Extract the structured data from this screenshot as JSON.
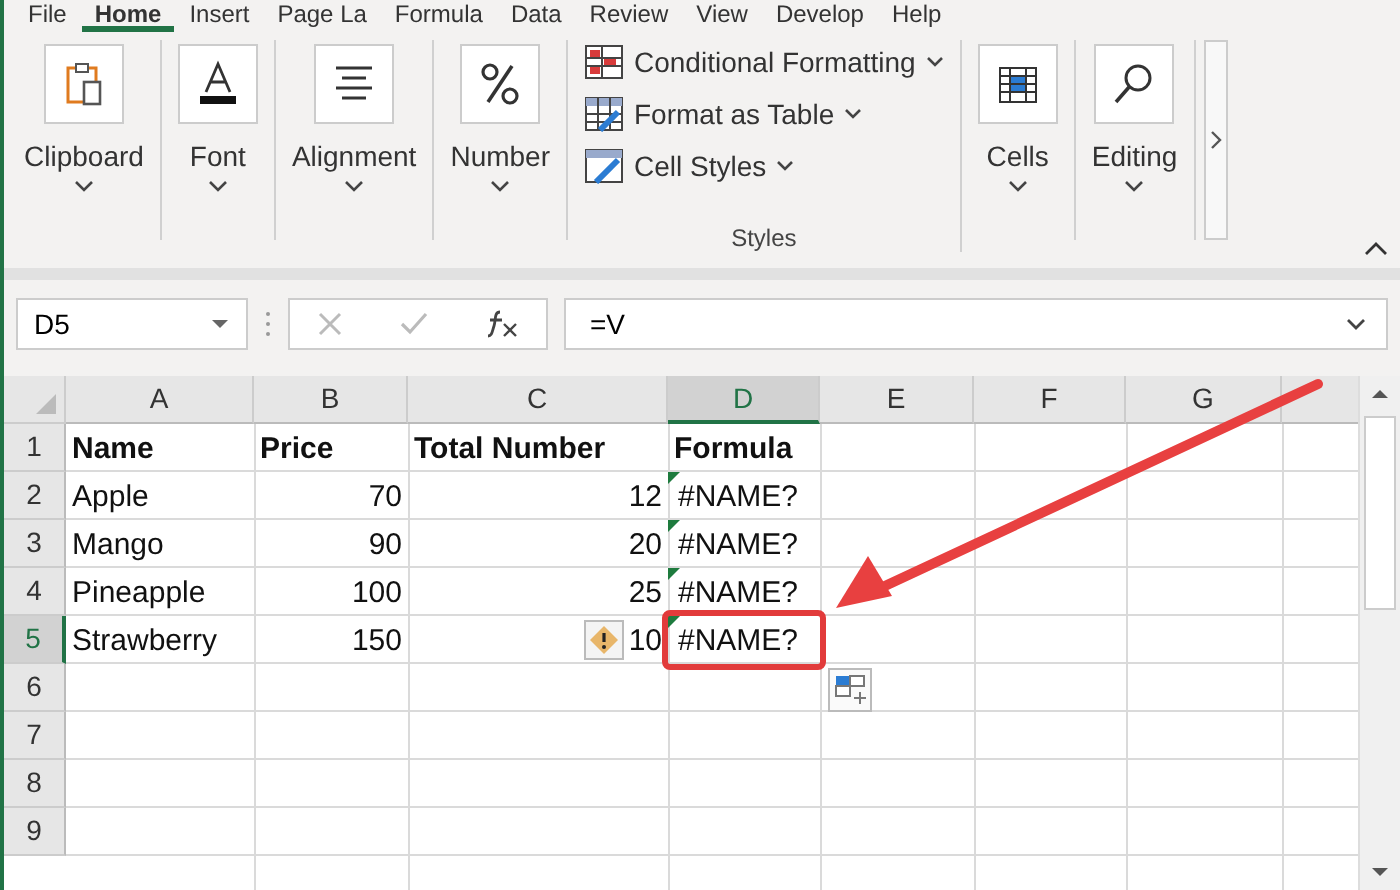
{
  "tabs": [
    {
      "label": "File",
      "selected": false
    },
    {
      "label": "Home",
      "selected": true
    },
    {
      "label": "Insert",
      "selected": false
    },
    {
      "label": "Page La",
      "selected": false
    },
    {
      "label": "Formula",
      "selected": false
    },
    {
      "label": "Data",
      "selected": false
    },
    {
      "label": "Review",
      "selected": false
    },
    {
      "label": "View",
      "selected": false
    },
    {
      "label": "Develop",
      "selected": false
    },
    {
      "label": "Help",
      "selected": false
    }
  ],
  "ribbon": {
    "groups": [
      {
        "kind": "clipboard",
        "label": "Clipboard"
      },
      {
        "kind": "font",
        "label": "Font"
      },
      {
        "kind": "alignment",
        "label": "Alignment"
      },
      {
        "kind": "number",
        "label": "Number"
      },
      {
        "kind": "styles",
        "label": "Styles",
        "items": [
          {
            "kind": "conditional",
            "label": "Conditional Formatting"
          },
          {
            "kind": "table",
            "label": "Format as Table"
          },
          {
            "kind": "cellstyles",
            "label": "Cell Styles"
          }
        ]
      },
      {
        "kind": "cells",
        "label": "Cells"
      },
      {
        "kind": "editing",
        "label": "Editing"
      }
    ]
  },
  "formula_bar": {
    "name_box": "D5",
    "formula": "=V"
  },
  "sheet": {
    "columns": [
      {
        "label": "A",
        "selected": false
      },
      {
        "label": "B",
        "selected": false
      },
      {
        "label": "C",
        "selected": false
      },
      {
        "label": "D",
        "selected": true
      },
      {
        "label": "E",
        "selected": false
      },
      {
        "label": "F",
        "selected": false
      },
      {
        "label": "G",
        "selected": false
      }
    ],
    "rows": [
      {
        "number": "1",
        "selected": false,
        "cells": [
          {
            "kind": "header",
            "text": "Name"
          },
          {
            "kind": "header",
            "text": "Price"
          },
          {
            "kind": "header",
            "text": "Total Number"
          },
          {
            "kind": "header",
            "text": "Formula"
          }
        ]
      },
      {
        "number": "2",
        "selected": false,
        "cells": [
          {
            "kind": "text",
            "text": "Apple"
          },
          {
            "kind": "number",
            "text": "70"
          },
          {
            "kind": "number",
            "text": "12"
          },
          {
            "kind": "error",
            "text": "#NAME?"
          }
        ]
      },
      {
        "number": "3",
        "selected": false,
        "cells": [
          {
            "kind": "text",
            "text": "Mango"
          },
          {
            "kind": "number",
            "text": "90"
          },
          {
            "kind": "number",
            "text": "20"
          },
          {
            "kind": "error",
            "text": "#NAME?"
          }
        ]
      },
      {
        "number": "4",
        "selected": false,
        "cells": [
          {
            "kind": "text",
            "text": "Pineapple"
          },
          {
            "kind": "number",
            "text": "100"
          },
          {
            "kind": "number",
            "text": "25"
          },
          {
            "kind": "error",
            "text": "#NAME?"
          }
        ]
      },
      {
        "number": "5",
        "selected": true,
        "cells": [
          {
            "kind": "text",
            "text": "Strawberry"
          },
          {
            "kind": "number",
            "text": "150"
          },
          {
            "kind": "number",
            "text": "10",
            "warning": true
          },
          {
            "kind": "error",
            "text": "#NAME?"
          }
        ]
      },
      {
        "number": "6",
        "selected": false,
        "cells": []
      },
      {
        "number": "7",
        "selected": false,
        "cells": []
      },
      {
        "number": "8",
        "selected": false,
        "cells": []
      },
      {
        "number": "9",
        "selected": false,
        "cells": []
      }
    ]
  }
}
